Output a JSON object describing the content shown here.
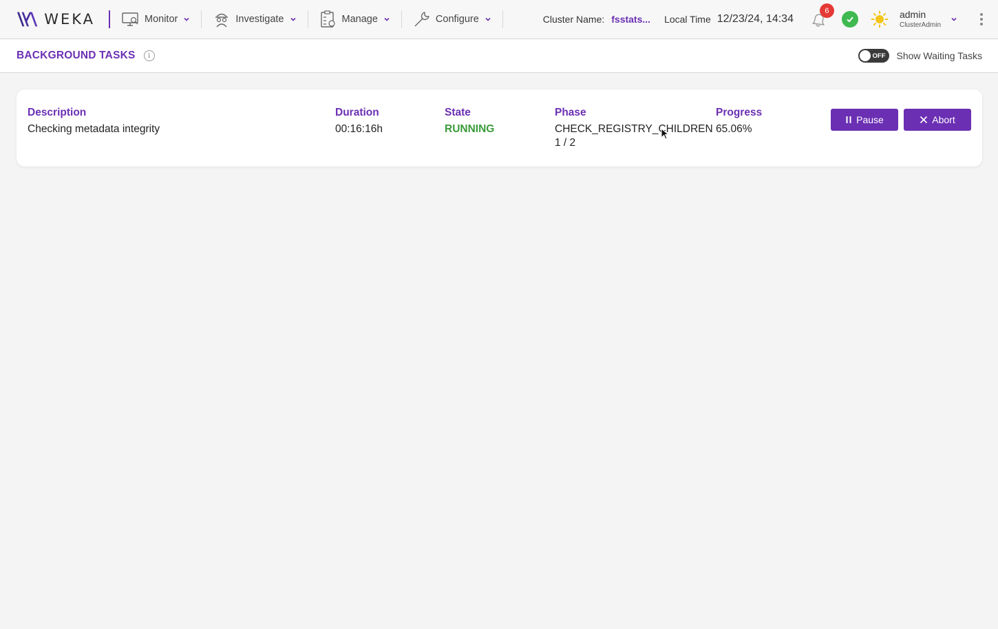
{
  "header": {
    "logo_text": "WEKA",
    "nav": [
      {
        "label": "Monitor"
      },
      {
        "label": "Investigate"
      },
      {
        "label": "Manage"
      },
      {
        "label": "Configure"
      }
    ],
    "cluster_label": "Cluster Name:",
    "cluster_name": "fsstats...",
    "local_time_label": "Local Time",
    "local_time": "12/23/24, 14:34",
    "notifications_count": "6",
    "user_name": "admin",
    "user_role": "ClusterAdmin"
  },
  "subheader": {
    "title": "BACKGROUND TASKS",
    "toggle_state": "OFF",
    "toggle_label": "Show Waiting Tasks"
  },
  "task": {
    "headers": {
      "description": "Description",
      "duration": "Duration",
      "state": "State",
      "phase": "Phase",
      "progress": "Progress"
    },
    "description": "Checking metadata integrity",
    "duration": "00:16:16h",
    "state": "RUNNING",
    "phase": "CHECK_REGISTRY_CHILDREN",
    "phase_step": "1 / 2",
    "progress": "65.06%",
    "pause_label": "Pause",
    "abort_label": "Abort"
  },
  "colors": {
    "accent": "#6b2fb3",
    "running": "#3a9a3a",
    "badge": "#e53935",
    "ok": "#3fb950"
  }
}
